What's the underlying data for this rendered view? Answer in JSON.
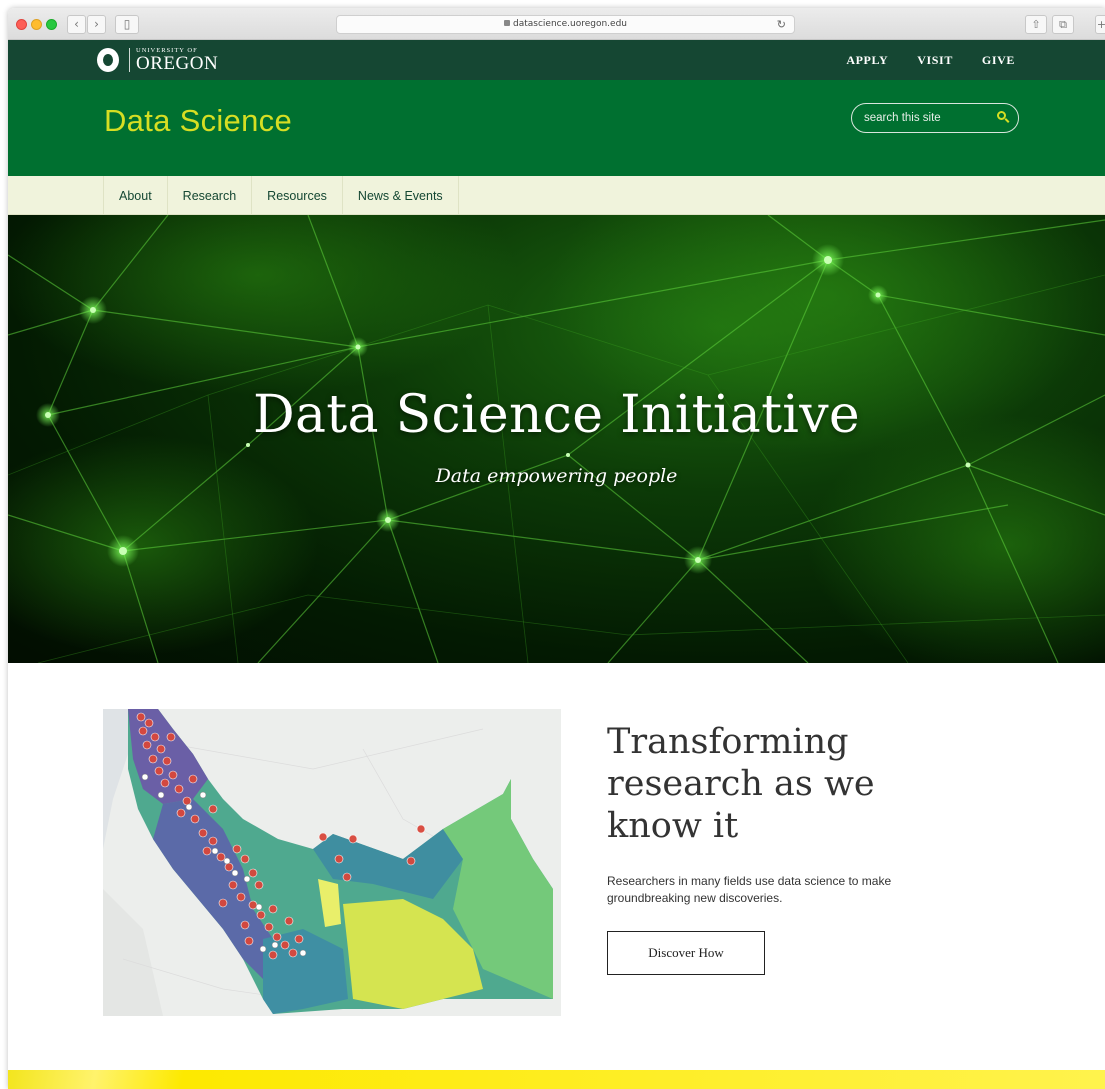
{
  "browser": {
    "url": "datascience.uoregon.edu"
  },
  "university": {
    "small": "UNIVERSITY OF",
    "big": "OREGON"
  },
  "toplinks": [
    "APPLY",
    "VISIT",
    "GIVE"
  ],
  "site_title": "Data Science",
  "search": {
    "placeholder": "search this site"
  },
  "nav": [
    "About",
    "Research",
    "Resources",
    "News & Events"
  ],
  "hero": {
    "title": "Data Science Initiative",
    "subtitle": "Data empowering people"
  },
  "feature": {
    "title": "Transforming research as we know it",
    "text": "Researchers in many fields use data science to make groundbreaking new discoveries.",
    "button": "Discover How"
  },
  "colors": {
    "dark_green": "#154733",
    "uo_green": "#007030",
    "uo_yellow": "#d6de23",
    "nav_bg": "#f0f3dc"
  }
}
